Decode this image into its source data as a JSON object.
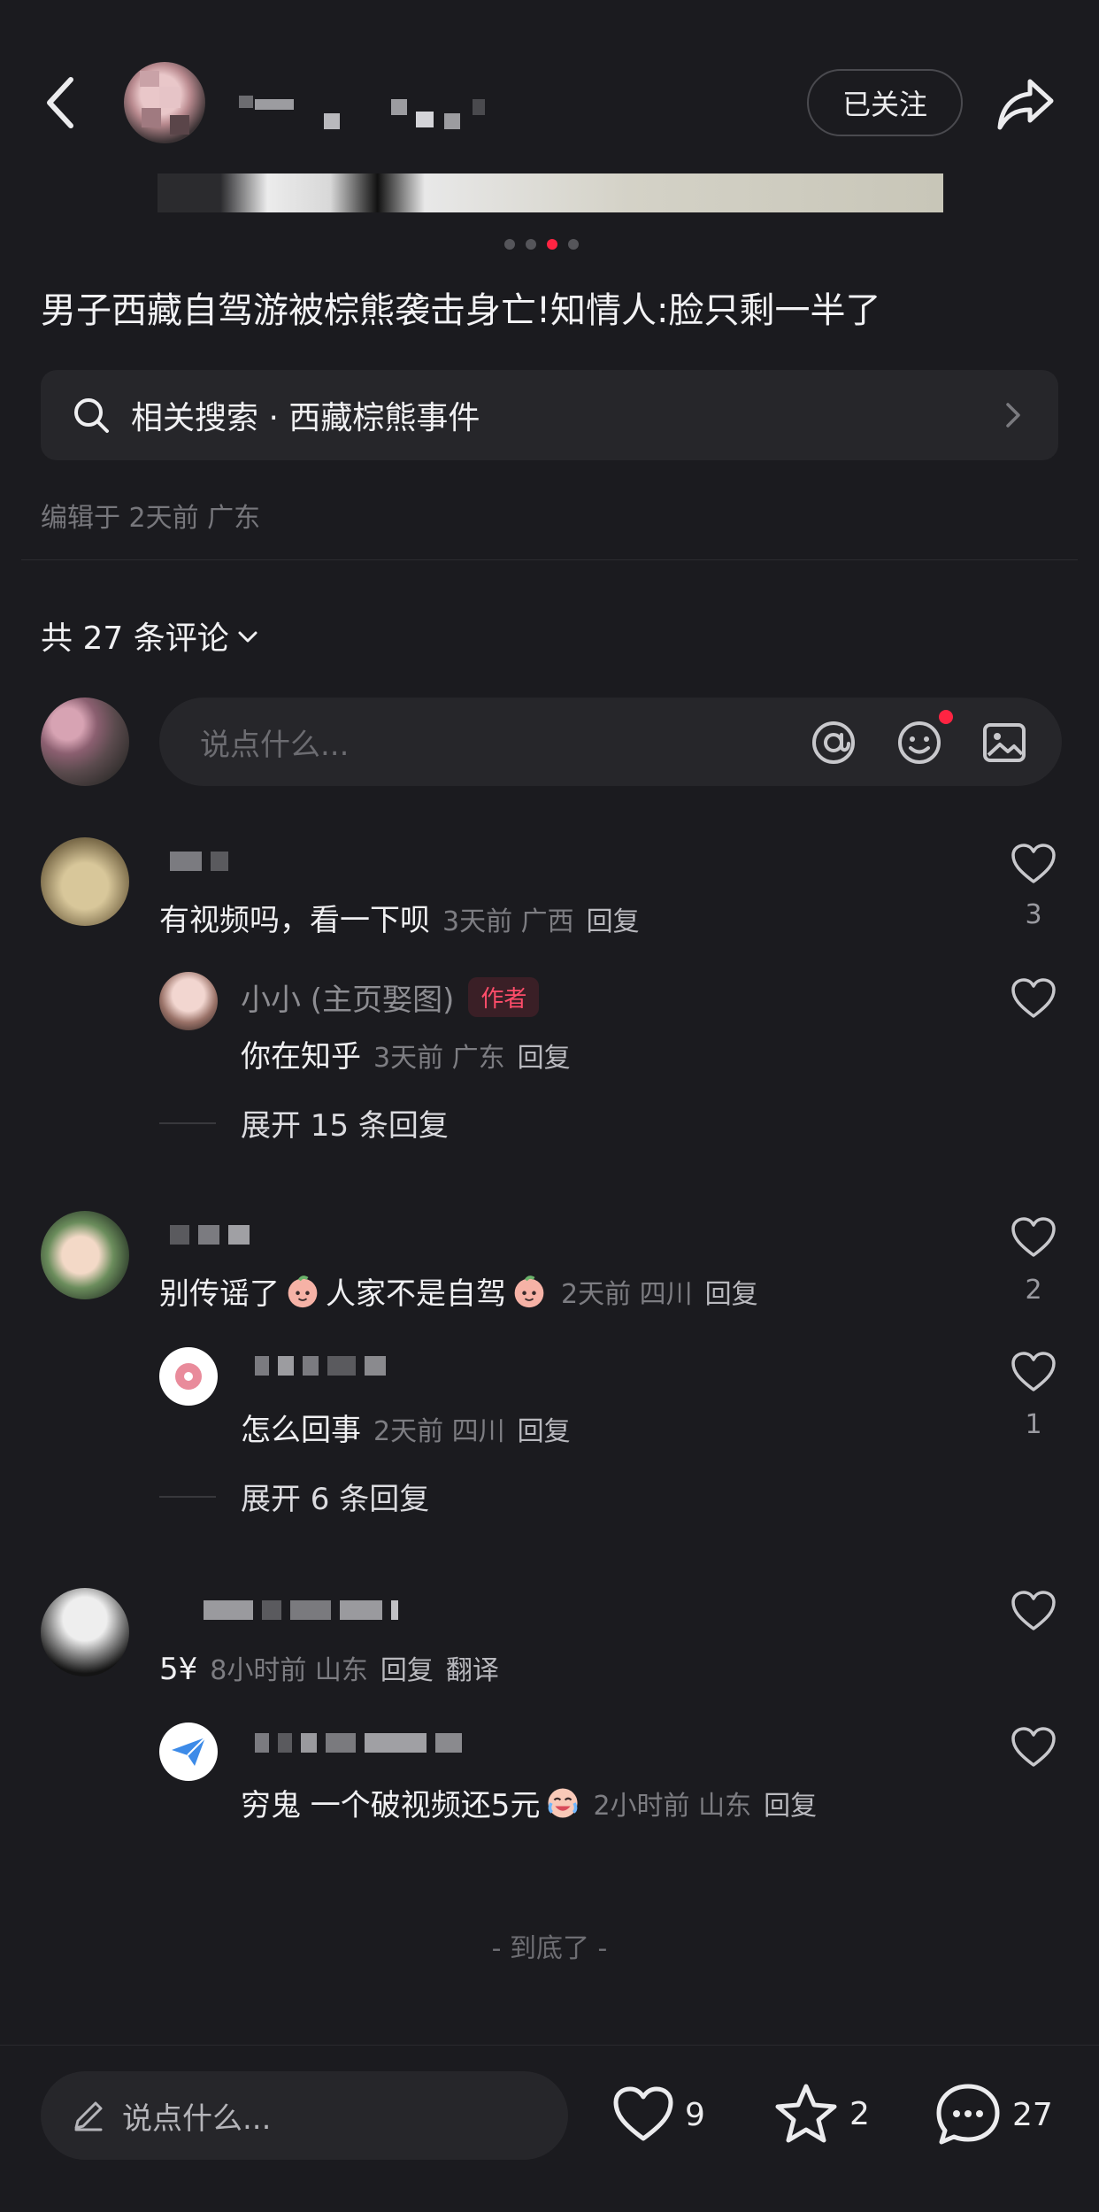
{
  "header": {
    "follow_label": "已关注",
    "back_icon": "chevron-left-icon",
    "share_icon": "share-icon"
  },
  "carousel": {
    "total": 4,
    "active_index": 2
  },
  "post": {
    "title": "男子西藏自驾游被棕熊袭击身亡!知情人:脸只剩一半了",
    "related_search_label": "相关搜索 · 西藏棕熊事件",
    "edit_meta": "编辑于 2天前 广东"
  },
  "comments_header": {
    "count_label": "共 27 条评论"
  },
  "comment_input": {
    "placeholder": "说点什么..."
  },
  "comments": [
    {
      "text": "有视频吗，看一下呗",
      "meta": "3天前 广西",
      "reply_label": "回复",
      "likes": "3",
      "replies": [
        {
          "author": "小小 (主页娶图)",
          "badge": "作者",
          "text": "你在知乎",
          "meta": "3天前 广东",
          "reply_label": "回复"
        }
      ],
      "expand_label": "展开 15 条回复"
    },
    {
      "text_part1": "别传谣了",
      "text_part2": "人家不是自驾",
      "meta": "2天前 四川",
      "reply_label": "回复",
      "likes": "2",
      "replies": [
        {
          "text": "怎么回事",
          "meta": "2天前 四川",
          "reply_label": "回复",
          "likes": "1"
        }
      ],
      "expand_label": "展开 6 条回复"
    },
    {
      "text": "5¥",
      "meta": "8小时前 山东",
      "reply_label": "回复",
      "translate_label": "翻译",
      "replies": [
        {
          "text": "穷鬼 一个破视频还5元",
          "meta": "2小时前 山东",
          "reply_label": "回复"
        }
      ]
    }
  ],
  "end_label": "- 到底了 -",
  "bottom_bar": {
    "input_placeholder": "说点什么...",
    "likes": "9",
    "favorites": "2",
    "comments": "27"
  },
  "colors": {
    "accent": "#ff2442",
    "background": "#1b1b1f"
  }
}
